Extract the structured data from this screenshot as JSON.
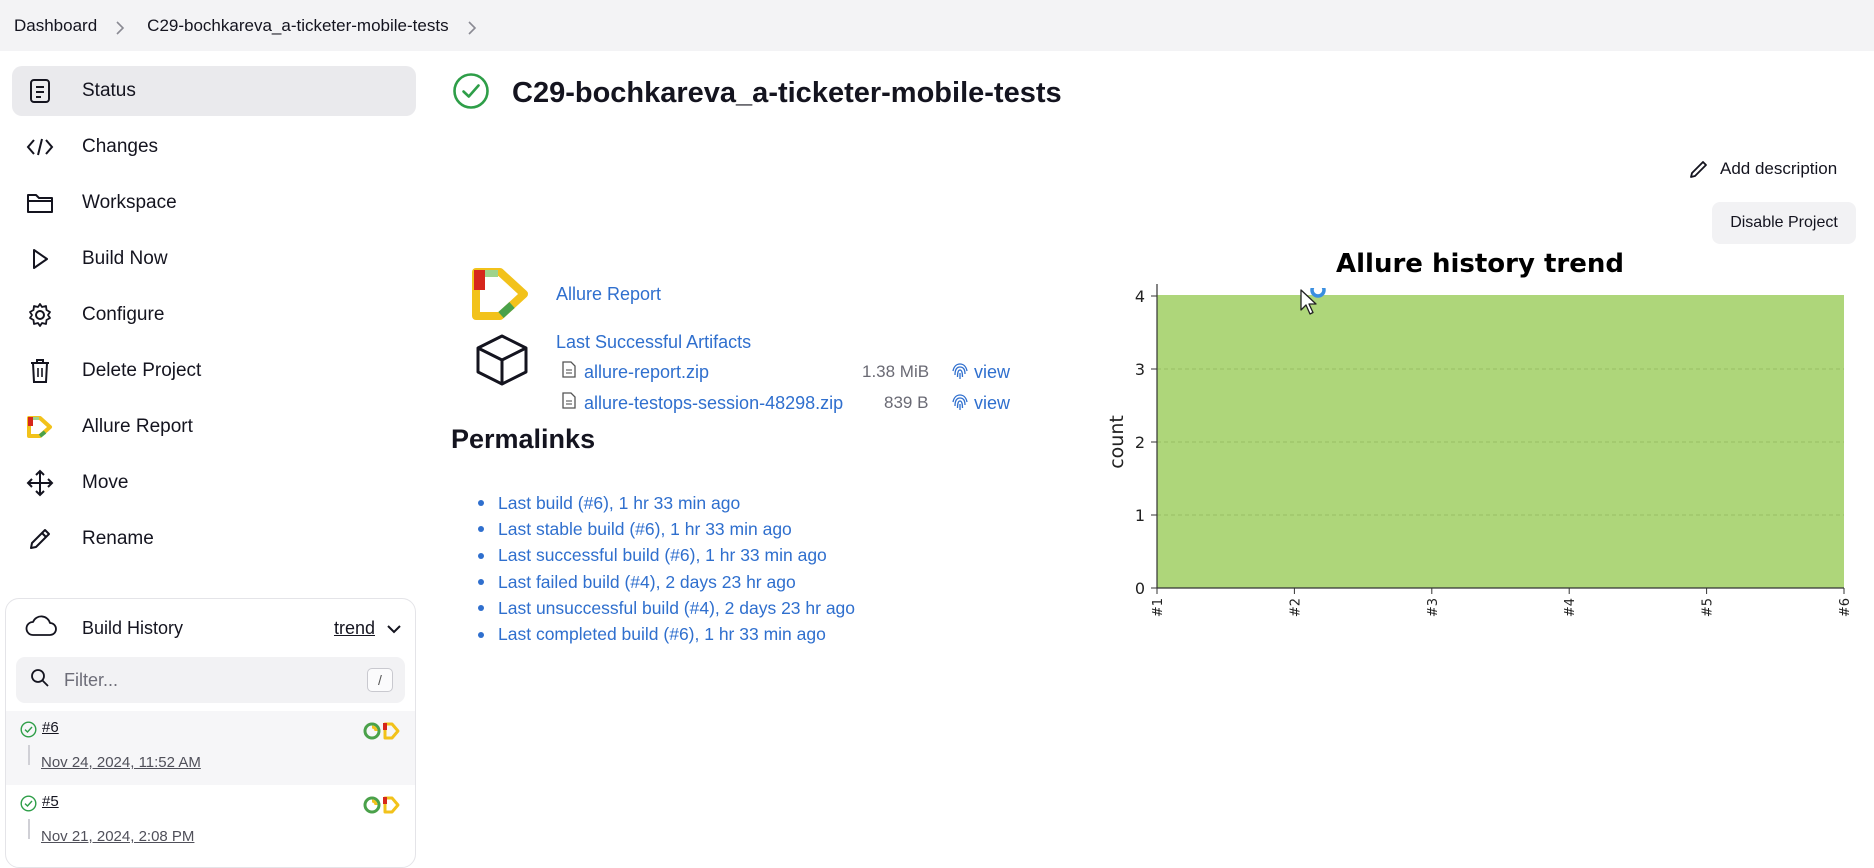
{
  "breadcrumb": {
    "items": [
      "Dashboard",
      "C29-bochkareva_a-ticketer-mobile-tests"
    ]
  },
  "sidebar": {
    "items": [
      {
        "label": "Status",
        "icon": "status-icon",
        "active": true
      },
      {
        "label": "Changes",
        "icon": "code-icon"
      },
      {
        "label": "Workspace",
        "icon": "folder-icon"
      },
      {
        "label": "Build Now",
        "icon": "play-icon"
      },
      {
        "label": "Configure",
        "icon": "gear-icon"
      },
      {
        "label": "Delete Project",
        "icon": "trash-icon"
      },
      {
        "label": "Allure Report",
        "icon": "allure-logo-icon"
      },
      {
        "label": "Move",
        "icon": "move-icon"
      },
      {
        "label": "Rename",
        "icon": "pencil-icon"
      }
    ]
  },
  "build_history": {
    "title": "Build History",
    "trend_label": "trend",
    "filter_placeholder": "Filter...",
    "filter_shortcut": "/",
    "builds": [
      {
        "number": "#6",
        "date": "Nov 24, 2024, 11:52 AM",
        "status": "success"
      },
      {
        "number": "#5",
        "date": "Nov 21, 2024, 2:08 PM",
        "status": "success"
      }
    ]
  },
  "main": {
    "title": "C29-bochkareva_a-ticketer-mobile-tests",
    "add_description_label": "Add description",
    "disable_button_label": "Disable Project",
    "allure_report_link": "Allure Report",
    "last_successful_artifacts_link": "Last Successful Artifacts",
    "artifacts": [
      {
        "name": "allure-report.zip",
        "size": "1.38 MiB",
        "view_label": "view"
      },
      {
        "name": "allure-testops-session-48298.zip",
        "size": "839 B",
        "view_label": "view"
      }
    ],
    "permalinks_title": "Permalinks",
    "permalinks": [
      "Last build (#6), 1 hr 33 min ago",
      "Last stable build (#6), 1 hr 33 min ago",
      "Last successful build (#6), 1 hr 33 min ago",
      "Last failed build (#4), 2 days 23 hr ago",
      "Last unsuccessful build (#4), 2 days 23 hr ago",
      "Last completed build (#6), 1 hr 33 min ago"
    ]
  },
  "colors": {
    "link": "#2f6fce",
    "success": "#2e9e48",
    "chart_fill": "#aed67a",
    "active_bg": "#eaeaed"
  },
  "chart_data": {
    "type": "area",
    "title": "Allure history trend",
    "xlabel": "",
    "ylabel": "count",
    "categories": [
      "#1",
      "#2",
      "#3",
      "#4",
      "#5",
      "#6"
    ],
    "series": [
      {
        "values": [
          4,
          4,
          4,
          4,
          4,
          4
        ],
        "color": "#aed67a"
      }
    ],
    "ylim": [
      0,
      4
    ],
    "yticks": [
      "0",
      "1",
      "2",
      "3",
      "4"
    ],
    "grid": true,
    "legend": "none"
  }
}
